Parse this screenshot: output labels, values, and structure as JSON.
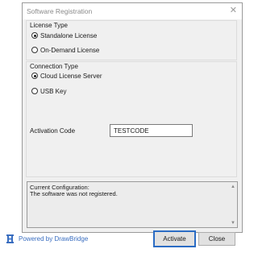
{
  "window": {
    "title": "Software Registration",
    "close_glyph": "✕"
  },
  "license_type": {
    "label": "License Type",
    "options": [
      {
        "label": "Standalone License",
        "checked": true
      },
      {
        "label": "On-Demand License",
        "checked": false
      }
    ]
  },
  "connection_type": {
    "label": "Connection Type",
    "options": [
      {
        "label": "Cloud License Server",
        "checked": true
      },
      {
        "label": "USB Key",
        "checked": false
      }
    ]
  },
  "activation_code": {
    "label": "Activation Code",
    "value": "TESTCODE"
  },
  "status": {
    "line1": "Current Configuration:",
    "line2": "The software was not registered."
  },
  "footer": {
    "powered_by": "Powered by DrawBridge",
    "logo_icon": "drawbridge-logo-icon",
    "activate_label": "Activate",
    "close_label": "Close",
    "accent_color": "#2b6cc4"
  }
}
